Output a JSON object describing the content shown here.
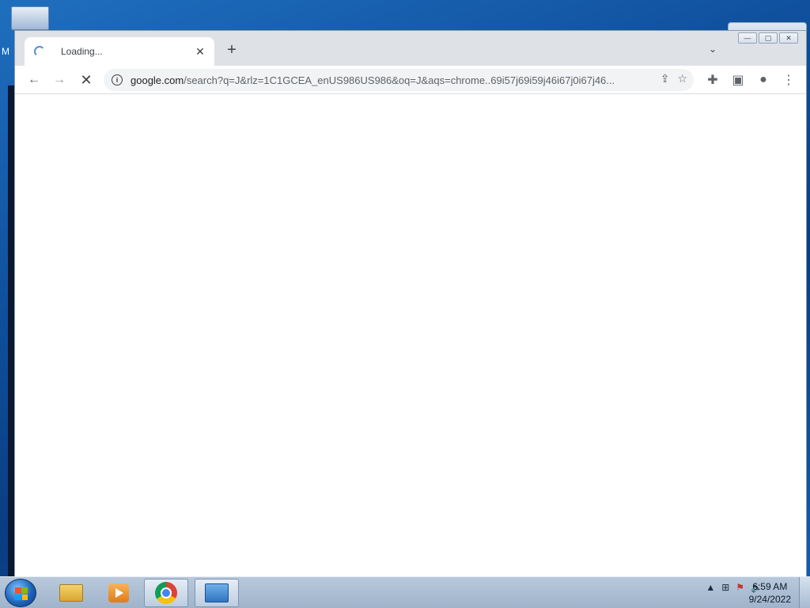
{
  "browser": {
    "tab": {
      "title": "Loading...",
      "close_glyph": "✕"
    },
    "new_tab_glyph": "+",
    "tab_search_glyph": "⌄",
    "toolbar": {
      "back_glyph": "←",
      "forward_glyph": "→",
      "stop_glyph": "✕",
      "info_glyph": "i",
      "url_host": "google.com",
      "url_path": "/search?q=J&rlz=1C1GCEA_enUS986US986&oq=J&aqs=chrome..69i57j69i59j46i67j0i67j46...",
      "share_glyph": "⇪",
      "bookmark_glyph": "☆",
      "extensions_glyph": "✚",
      "sidepanel_glyph": "▣",
      "profile_glyph": "●",
      "menu_glyph": "⋮"
    }
  },
  "frame": {
    "minimize": "—",
    "maximize": "▢",
    "close": "✕"
  },
  "taskbar": {
    "clock": {
      "time": "6:59 AM",
      "date": "9/24/2022"
    },
    "tray": {
      "arrow": "▲",
      "network": "⊞",
      "flag": "⚑",
      "volume": "🔊"
    }
  },
  "desktop": {
    "edge_letter": "M"
  }
}
